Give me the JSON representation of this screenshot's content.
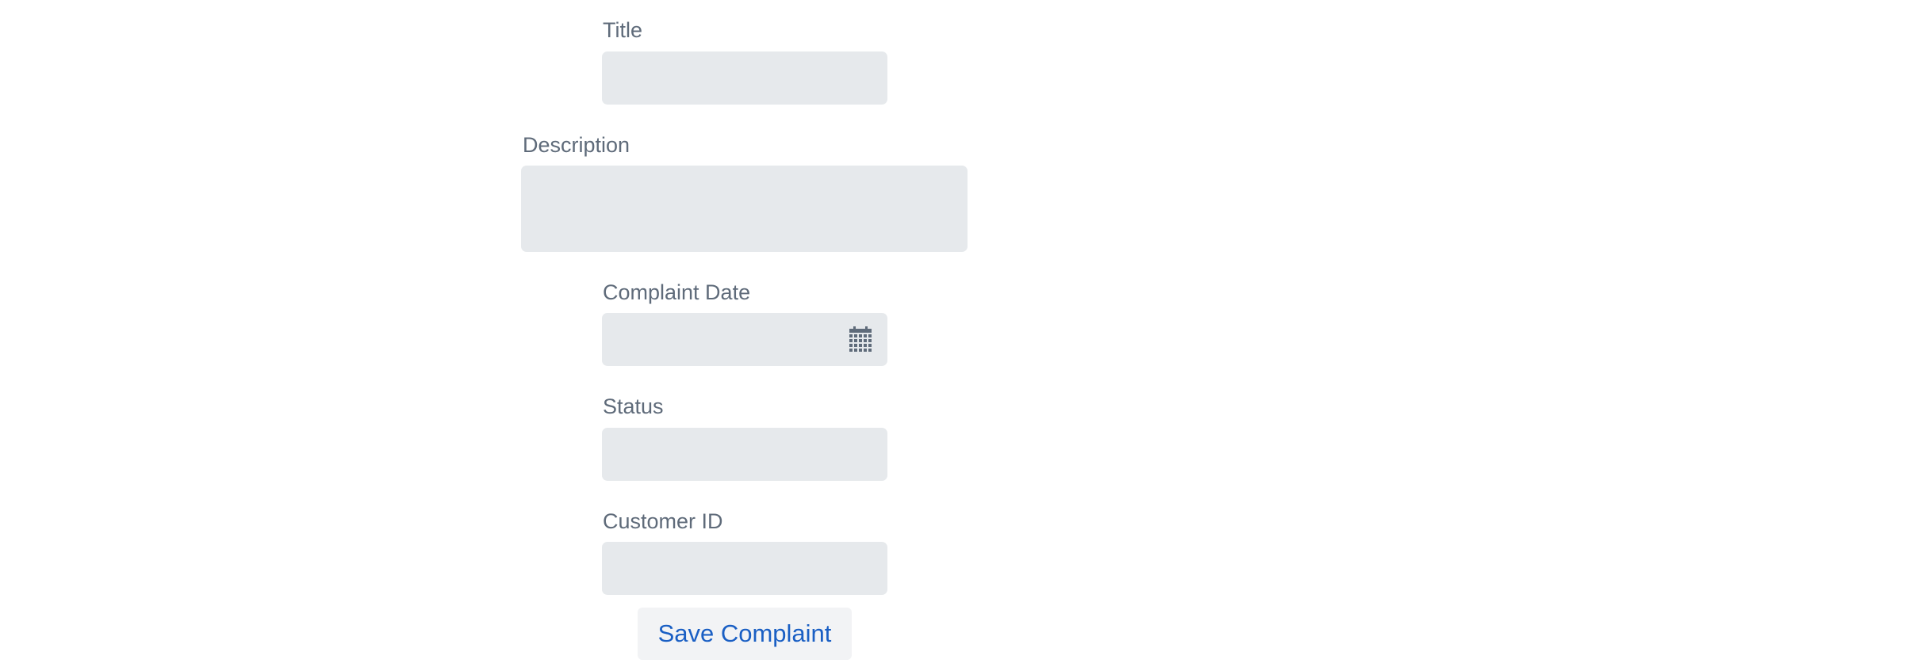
{
  "form": {
    "title_label": "Title",
    "title_value": "",
    "description_label": "Description",
    "description_value": "",
    "complaint_date_label": "Complaint Date",
    "complaint_date_value": "",
    "status_label": "Status",
    "status_value": "",
    "customer_id_label": "Customer ID",
    "customer_id_value": "",
    "save_button_label": "Save Complaint",
    "calendar_icon": "calendar-icon"
  },
  "colors": {
    "label": "#5f6b7a",
    "field_bg": "#e6e9ec",
    "button_text": "#1a5fc4",
    "button_bg": "#f2f3f5"
  }
}
